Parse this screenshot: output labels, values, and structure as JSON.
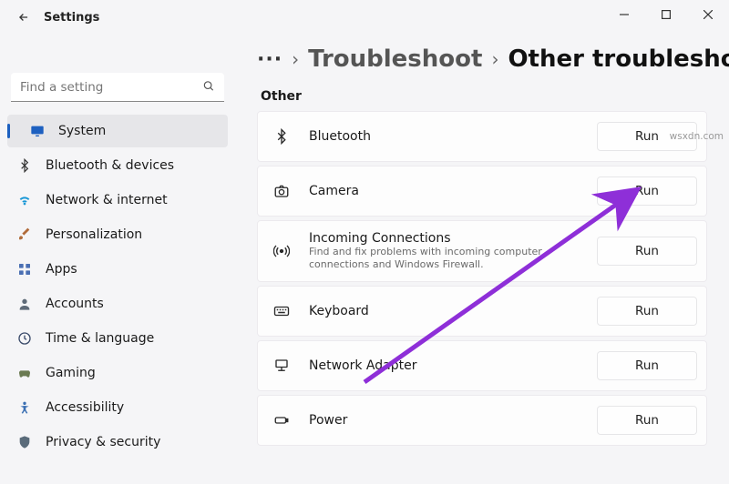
{
  "window": {
    "title": "Settings"
  },
  "search": {
    "placeholder": "Find a setting"
  },
  "nav": [
    {
      "key": "system",
      "label": "System",
      "icon": "🖥️",
      "color": "#1d60c0",
      "selected": true
    },
    {
      "key": "bluetooth",
      "label": "Bluetooth & devices",
      "icon": "🖱️",
      "color": "#333",
      "selected": false
    },
    {
      "key": "network",
      "label": "Network & internet",
      "icon": "📶",
      "color": "#1a98d6",
      "selected": false
    },
    {
      "key": "personalize",
      "label": "Personalization",
      "icon": "🖌️",
      "color": "#b06b3a",
      "selected": false
    },
    {
      "key": "apps",
      "label": "Apps",
      "icon": "🗂️",
      "color": "#4a6fb3",
      "selected": false
    },
    {
      "key": "accounts",
      "label": "Accounts",
      "icon": "👤",
      "color": "#5f6b78",
      "selected": false
    },
    {
      "key": "time",
      "label": "Time & language",
      "icon": "🕒",
      "color": "#3a4a6a",
      "selected": false
    },
    {
      "key": "gaming",
      "label": "Gaming",
      "icon": "🎮",
      "color": "#6a7a52",
      "selected": false
    },
    {
      "key": "accessibility",
      "label": "Accessibility",
      "icon": "♿",
      "color": "#3a6fb3",
      "selected": false
    },
    {
      "key": "privacy",
      "label": "Privacy & security",
      "icon": "🛡️",
      "color": "#5a6b7a",
      "selected": false
    }
  ],
  "breadcrumb": {
    "ellipsis": "···",
    "prev": "Troubleshoot",
    "curr": "Other troubleshooters"
  },
  "section_label": "Other",
  "troubleshooters": [
    {
      "key": "bluetooth",
      "title": "Bluetooth",
      "desc": "",
      "button": "Run"
    },
    {
      "key": "camera",
      "title": "Camera",
      "desc": "",
      "button": "Run"
    },
    {
      "key": "incoming",
      "title": "Incoming Connections",
      "desc": "Find and fix problems with incoming computer connections and Windows Firewall.",
      "button": "Run"
    },
    {
      "key": "keyboard",
      "title": "Keyboard",
      "desc": "",
      "button": "Run"
    },
    {
      "key": "network",
      "title": "Network Adapter",
      "desc": "",
      "button": "Run"
    },
    {
      "key": "power",
      "title": "Power",
      "desc": "",
      "button": "Run"
    }
  ],
  "watermark": "wsxdn.com",
  "colors": {
    "accent": "#1d60c0",
    "annotation_arrow": "#8e2fd8"
  }
}
